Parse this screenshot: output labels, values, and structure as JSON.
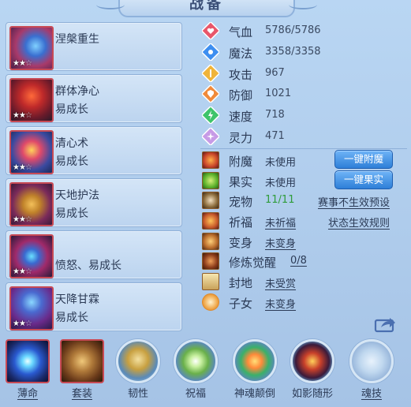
{
  "title": "战备",
  "skills": [
    {
      "name": "涅槃重生",
      "desc": "",
      "stars": 2,
      "max_stars": 3
    },
    {
      "name": "群体净心",
      "desc": "易成长",
      "stars": 2,
      "max_stars": 3
    },
    {
      "name": "清心术",
      "desc": "易成长",
      "stars": 2,
      "max_stars": 3
    },
    {
      "name": "天地护法",
      "desc": "易成长",
      "stars": 2,
      "max_stars": 3
    },
    {
      "name": "",
      "desc": "愤怒、易成长",
      "stars": 2,
      "max_stars": 3
    },
    {
      "name": "天降甘霖",
      "desc": "易成长",
      "stars": 2,
      "max_stars": 3
    }
  ],
  "stats": [
    {
      "label": "气血",
      "value": "5786/5786",
      "icon": "heart-icon",
      "color": "#e8566a"
    },
    {
      "label": "魔法",
      "value": "3358/3358",
      "icon": "mana-icon",
      "color": "#3d8ef0"
    },
    {
      "label": "攻击",
      "value": "967",
      "icon": "attack-icon",
      "color": "#f0b43a"
    },
    {
      "label": "防御",
      "value": "1021",
      "icon": "defense-icon",
      "color": "#f08a3a"
    },
    {
      "label": "速度",
      "value": "718",
      "icon": "speed-icon",
      "color": "#3ec46a"
    },
    {
      "label": "灵力",
      "value": "471",
      "icon": "spirit-icon",
      "color": "#c79be6"
    }
  ],
  "extras": [
    {
      "label": "附魔",
      "value": "未使用",
      "button": "一键附魔"
    },
    {
      "label": "果实",
      "value": "未使用",
      "button": "一键果实"
    },
    {
      "label": "宠物",
      "value": "11/11",
      "right": "赛事不生效预设"
    },
    {
      "label": "祈福",
      "value": "未祈福",
      "right": "状态生效规则"
    },
    {
      "label": "变身",
      "value": "未变身"
    },
    {
      "label": "修炼觉醒",
      "value": "0/8"
    },
    {
      "label": "封地",
      "value": "未受赏"
    },
    {
      "label": "子女",
      "value": "未变身"
    }
  ],
  "bottom": [
    {
      "label": "薄命",
      "icon": "fate-orb-icon"
    },
    {
      "label": "套装",
      "icon": "armor-set-icon"
    },
    {
      "label": "韧性",
      "icon": "toughness-icon"
    },
    {
      "label": "祝福",
      "icon": "blessing-icon"
    },
    {
      "label": "神魂颠倒",
      "icon": "soul-icon"
    },
    {
      "label": "如影随形",
      "icon": "shadow-icon"
    },
    {
      "label": "魂技",
      "icon": "soul-skill-icon"
    }
  ]
}
